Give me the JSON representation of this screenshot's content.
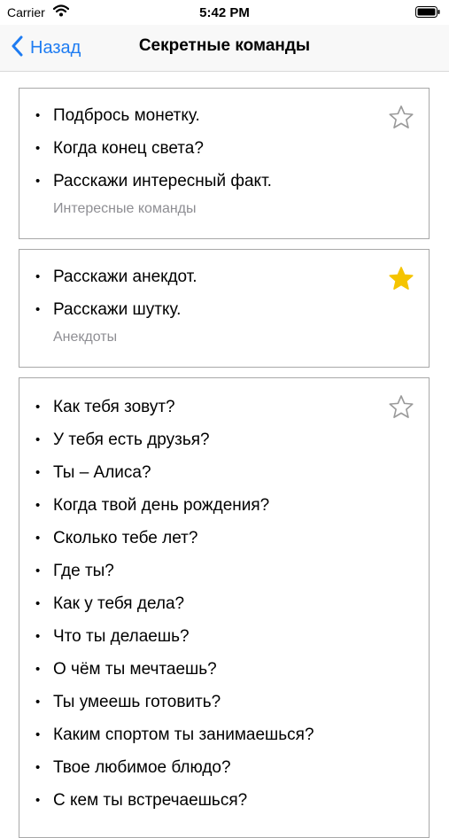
{
  "status_bar": {
    "carrier": "Carrier",
    "time": "5:42 PM"
  },
  "nav": {
    "back_label": "Назад",
    "title": "Секретные команды"
  },
  "colors": {
    "accent": "#1e7cf2",
    "star_active": "#f5c400",
    "star_inactive": "#9a9a9a"
  },
  "cards": [
    {
      "favorite": false,
      "commands": [
        "Подбрось монетку.",
        "Когда конец света?",
        "Расскажи интересный факт."
      ],
      "category": "Интересные команды"
    },
    {
      "favorite": true,
      "commands": [
        "Расскажи анекдот.",
        "Расскажи шутку."
      ],
      "category": "Анекдоты"
    },
    {
      "favorite": false,
      "commands": [
        "Как тебя зовут?",
        "У тебя есть друзья?",
        "Ты – Алиса?",
        "Когда твой день рождения?",
        "Сколько тебе лет?",
        "Где ты?",
        "Как у тебя дела?",
        "Что ты делаешь?",
        "О чём ты мечтаешь?",
        "Ты умеешь готовить?",
        "Каким спортом ты занимаешься?",
        "Твое любимое блюдо?",
        "С кем ты встречаешься?"
      ]
    }
  ]
}
